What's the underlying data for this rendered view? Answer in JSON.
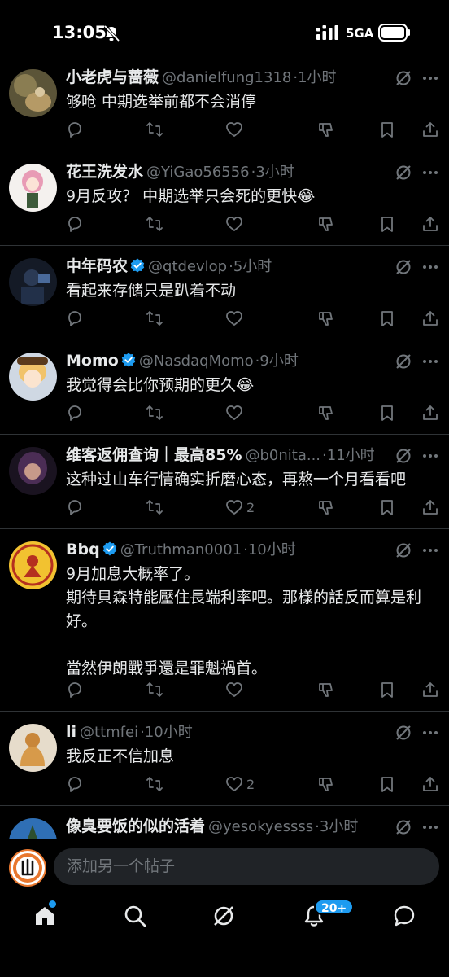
{
  "status_bar": {
    "time": "13:05",
    "network": "5GA"
  },
  "posts": [
    {
      "name": "小老虎与蔷薇",
      "handle": "@danielfung1318",
      "time": "·1小时",
      "verified": false,
      "text": "够呛 中期选举前都不会消停",
      "likes": ""
    },
    {
      "name": "花王洗发水",
      "handle": "@YiGao56556",
      "time": "·3小时",
      "verified": false,
      "text": "9月反攻？ 中期选举只会死的更快😂",
      "likes": ""
    },
    {
      "name": "中年码农",
      "handle": "@qtdevlop",
      "time": "·5小时",
      "verified": true,
      "text": "看起来存储只是趴着不动",
      "likes": ""
    },
    {
      "name": "Momo",
      "handle": "@NasdaqMomo",
      "time": "·9小时",
      "verified": true,
      "text": "我觉得会比你预期的更久😂",
      "likes": ""
    },
    {
      "name": "维客返佣查询｜最高85%",
      "handle": "@b0nita...",
      "time": "·11小时",
      "verified": false,
      "text": "这种过山车行情确实折磨心态，再熬一个月看看吧",
      "likes": "2"
    },
    {
      "name": "Bbq",
      "handle": "@Truthman0001",
      "time": "·10小时",
      "verified": true,
      "text": "9月加息大概率了。\n期待貝森特能壓住長端利率吧。那樣的話反而算是利好。\n\n當然伊朗戰爭還是罪魁禍首。",
      "likes": ""
    },
    {
      "name": "li",
      "handle": "@ttmfei",
      "time": "·10小时",
      "verified": false,
      "text": "我反正不信加息",
      "likes": "2"
    },
    {
      "name": "像臭要饭的似的活着",
      "handle": "@yesokyessss",
      "time": "·3小时",
      "verified": false,
      "text": "",
      "likes": ""
    }
  ],
  "compose": {
    "placeholder": "添加另一个帖子"
  },
  "nav": {
    "notifications_badge": "20+"
  },
  "icons": {
    "actions": [
      "reply-icon",
      "repost-icon",
      "like-icon",
      "downvote-icon",
      "bookmark-icon",
      "share-icon"
    ],
    "nav": [
      "home-icon",
      "search-icon",
      "grok-icon",
      "notifications-icon",
      "messages-icon"
    ]
  },
  "colors": {
    "accent": "#1d9bf0",
    "muted": "#71767b",
    "text": "#e7e9ea",
    "background": "#000000"
  }
}
